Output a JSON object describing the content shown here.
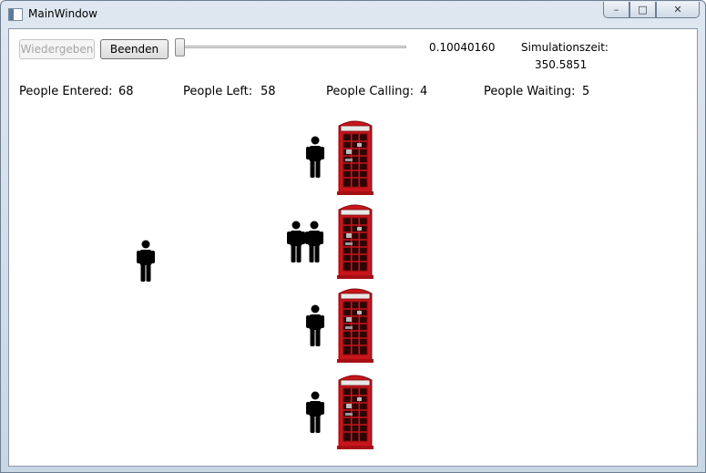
{
  "window": {
    "title": "MainWindow",
    "minimize_label": "–",
    "maximize_label": "□",
    "close_label": "✕"
  },
  "toolbar": {
    "play_label": "Wiedergeben",
    "stop_label": "Beenden",
    "slider_value_text": "0.10040160",
    "sim_time_label": "Simulationszeit:",
    "sim_time_value": "350.5851",
    "slider_fraction": 0.0
  },
  "stats": {
    "entered_label": "People Entered:",
    "entered_value": "68",
    "left_label": "People Left:",
    "left_value": "58",
    "calling_label": "People Calling:",
    "calling_value": "4",
    "waiting_label": "People Waiting:",
    "waiting_value": "5"
  },
  "scene": {
    "booth_color": "#c8151b",
    "icons": [
      "phone-booth-icon",
      "person-icon"
    ]
  }
}
